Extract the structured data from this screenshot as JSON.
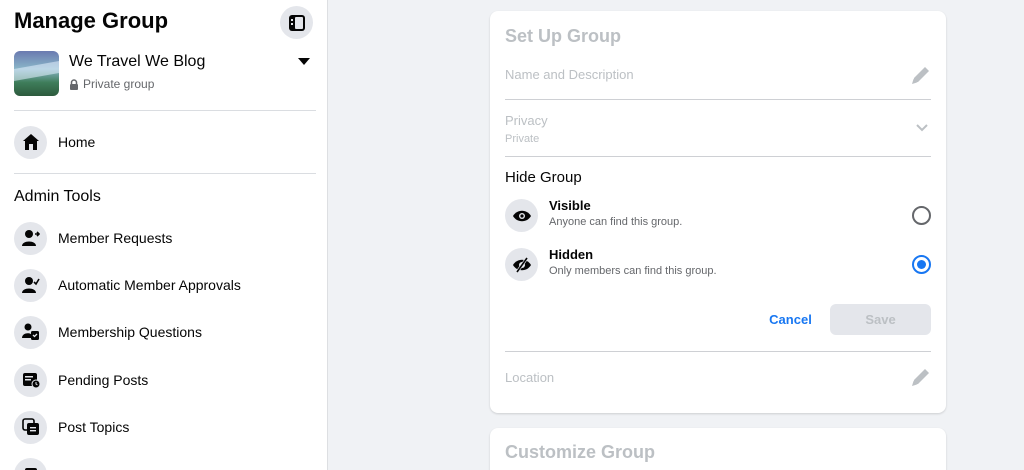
{
  "sidebar": {
    "title": "Manage Group",
    "group": {
      "name": "We Travel We Blog",
      "privacy": "Private group"
    },
    "home_label": "Home",
    "admin_tools_title": "Admin Tools",
    "items": [
      {
        "label": "Member Requests",
        "icon": "member-requests-icon"
      },
      {
        "label": "Automatic Member Approvals",
        "icon": "auto-approvals-icon"
      },
      {
        "label": "Membership Questions",
        "icon": "membership-questions-icon"
      },
      {
        "label": "Pending Posts",
        "icon": "pending-posts-icon"
      },
      {
        "label": "Post Topics",
        "icon": "post-topics-icon"
      }
    ]
  },
  "setup": {
    "title": "Set Up Group",
    "name_desc_label": "Name and Description",
    "privacy_label": "Privacy",
    "privacy_value": "Private",
    "hide_title": "Hide Group",
    "options": [
      {
        "title": "Visible",
        "desc": "Anyone can find this group.",
        "selected": false
      },
      {
        "title": "Hidden",
        "desc": "Only members can find this group.",
        "selected": true
      }
    ],
    "cancel_label": "Cancel",
    "save_label": "Save",
    "location_label": "Location"
  },
  "customize": {
    "title": "Customize Group"
  },
  "colors": {
    "accent": "#1877f2",
    "page_bg": "#f0f2f5",
    "disabled_text": "#bcc0c4"
  }
}
